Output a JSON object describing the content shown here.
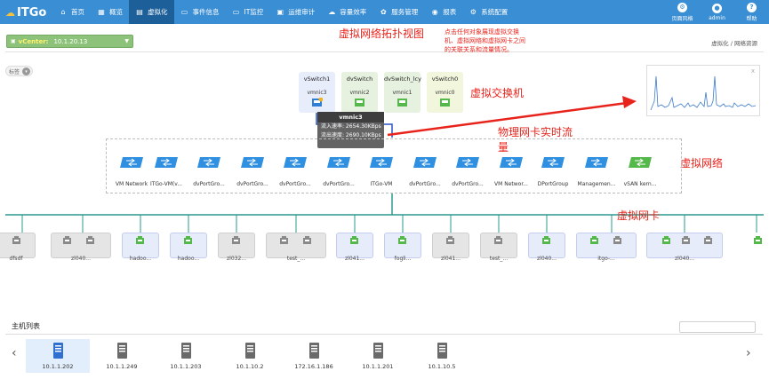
{
  "brand": {
    "name": "ITGo"
  },
  "nav": [
    {
      "label": "首页",
      "icon": "home-icon",
      "active": false
    },
    {
      "label": "概览",
      "icon": "grid-icon",
      "active": false
    },
    {
      "label": "虚拟化",
      "icon": "server-stack-icon",
      "active": true
    },
    {
      "label": "事件信息",
      "icon": "document-icon",
      "active": false
    },
    {
      "label": "IT监控",
      "icon": "monitor-icon",
      "active": false
    },
    {
      "label": "运维审计",
      "icon": "audit-icon",
      "active": false
    },
    {
      "label": "容量效率",
      "icon": "cloud-icon",
      "active": false
    },
    {
      "label": "服务管理",
      "icon": "service-icon",
      "active": false
    },
    {
      "label": "报表",
      "icon": "report-icon",
      "active": false
    },
    {
      "label": "系统配置",
      "icon": "gear-icon",
      "active": false
    }
  ],
  "nav_right": [
    {
      "label": "页面风格",
      "icon": "style-icon",
      "glyph": "⚙"
    },
    {
      "label": "admin",
      "icon": "user-icon",
      "glyph": "●"
    },
    {
      "label": "帮助",
      "icon": "help-icon",
      "glyph": "?"
    }
  ],
  "context": {
    "vcenter_label": "vCenter:",
    "vcenter_ip": "10.1.20.13",
    "breadcrumb": "虚拟化 / 网络资源"
  },
  "tag_toggle": "标签",
  "annotations": {
    "topology": "虚拟网络拓扑视图",
    "hint": "点击任何对象展现虚拟交换机、虚拟网络和虚拟网卡之间的关联关系和流量情况。",
    "vswitch": "虚拟交换机",
    "realtime": "物理网卡实时流量",
    "network": "虚拟网络",
    "vnic": "虚拟网卡"
  },
  "vswitches": [
    {
      "name": "vSwitch1",
      "nic": "vmnic3"
    },
    {
      "name": "dvSwitch",
      "nic": "vmnic2"
    },
    {
      "name": "dvSwitch_lcy",
      "nic": "vmnic1"
    },
    {
      "name": "vSwitch0",
      "nic": "vmnic0"
    }
  ],
  "tooltip": {
    "title": "vmnic3",
    "rx": "流入速率: 2654.30KBps",
    "tx": "流出速度: 2690.10KBps"
  },
  "networks": [
    "VM Network",
    "ITGo-VM(v...",
    "dvPortGro...",
    "dvPortGro...",
    "dvPortGro...",
    "dvPortGro...",
    "ITGo-VM",
    "dvPortGro...",
    "dvPortGro...",
    "VM Networ...",
    "DPortGroup",
    "Managemen...",
    "vSAN kern..."
  ],
  "vnics": [
    "dfsdf",
    "zl040...",
    "hadoo...",
    "hadoo...",
    "zl032...",
    "test_...",
    "zl041...",
    "fogli...",
    "zl041...",
    "test_...",
    "zl040...",
    "itgo-...",
    "zl040..."
  ],
  "hosts": {
    "title": "主机列表",
    "items": [
      "10.1.1.202",
      "10.1.1.249",
      "10.1.1.203",
      "10.1.10.2",
      "172.16.1.186",
      "10.1.1.201",
      "10.1.10.5"
    ]
  },
  "colors": {
    "nav_bg": "#3a8ed3",
    "nav_active": "#1d5f99",
    "annotation": "#e8231b",
    "vcenter_bg": "#8dc27a",
    "network_blue": "#2f8fe0",
    "network_green": "#55b84a",
    "link": "#2a9a8e"
  }
}
